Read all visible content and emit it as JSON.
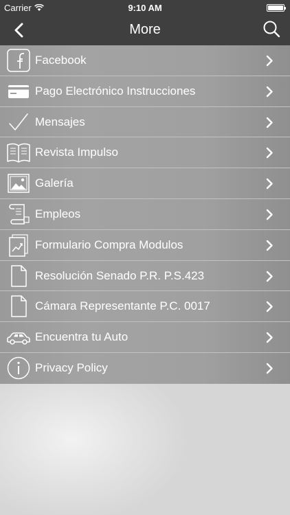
{
  "status": {
    "carrier": "Carrier",
    "time": "9:10 AM"
  },
  "nav": {
    "title": "More",
    "back_icon": "chevron-left-icon",
    "search_icon": "search-icon"
  },
  "menu": [
    {
      "label": "Facebook",
      "icon": "facebook-icon"
    },
    {
      "label": "Pago Electrónico Instrucciones",
      "icon": "credit-card-icon"
    },
    {
      "label": "Mensajes",
      "icon": "checkmark-icon"
    },
    {
      "label": "Revista Impulso",
      "icon": "open-book-icon"
    },
    {
      "label": "Galería",
      "icon": "picture-icon"
    },
    {
      "label": "Empleos",
      "icon": "scroll-document-icon"
    },
    {
      "label": "Formulario Compra Modulos",
      "icon": "chart-document-icon"
    },
    {
      "label": "Resolución Senado P.R. P.S.423",
      "icon": "document-icon"
    },
    {
      "label": "Cámara Representante P.C. 0017",
      "icon": "document-icon"
    },
    {
      "label": "Encuentra tu Auto",
      "icon": "car-icon"
    },
    {
      "label": "Privacy Policy",
      "icon": "info-icon"
    }
  ],
  "colors": {
    "bar": "#3f3f3f",
    "list_bg": "#a0a0a0",
    "text": "#ffffff"
  }
}
